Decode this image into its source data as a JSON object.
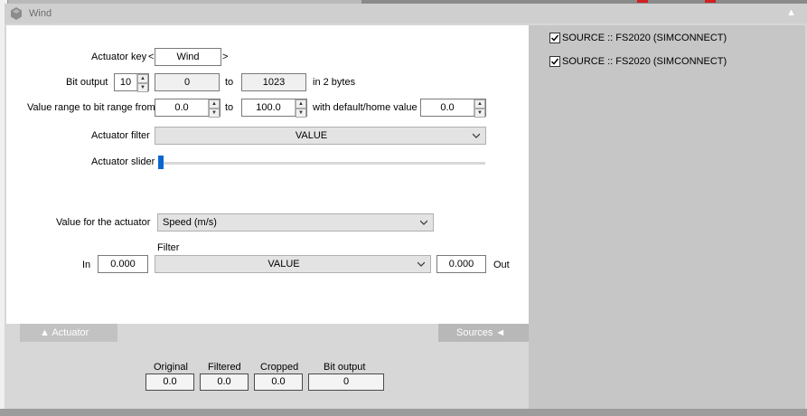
{
  "window": {
    "title": "Wind"
  },
  "actuator_key": {
    "label": "Actuator key",
    "open": "<",
    "value": "Wind",
    "close": ">"
  },
  "bit_output": {
    "label": "Bit output",
    "bits": "10",
    "from": "0",
    "to_label": "to",
    "to": "1023",
    "suffix": "in 2 bytes"
  },
  "value_range": {
    "label": "Value range to bit range from",
    "from": "0.0",
    "to_label": "to",
    "to": "100.0",
    "default_label": "with default/home value",
    "default": "0.0"
  },
  "actuator_filter": {
    "label": "Actuator filter",
    "value": "VALUE"
  },
  "actuator_slider": {
    "label": "Actuator slider",
    "level": 0
  },
  "value_for_actuator": {
    "label": "Value for the actuator",
    "value": "Speed (m/s)"
  },
  "filter": {
    "label": "Filter",
    "in_label": "In",
    "in_value": "0.000",
    "value": "VALUE",
    "out_value": "0.000",
    "out_label": "Out"
  },
  "tabs": {
    "actuator": "▲  Actuator",
    "sources": "Sources  ◄"
  },
  "outputs": {
    "original_label": "Original",
    "original": "0.0",
    "filtered_label": "Filtered",
    "filtered": "0.0",
    "cropped_label": "Cropped",
    "cropped": "0.0",
    "bit_output_label": "Bit output",
    "bit_output": "0"
  },
  "sources": [
    {
      "label": "SOURCE :: FS2020 (SIMCONNECT)",
      "checked": true
    },
    {
      "label": "SOURCE :: FS2020 (SIMCONNECT)",
      "checked": true
    }
  ],
  "colors": {
    "accent": "#0a67d0",
    "tab_bg": "#b8b8b8",
    "right_panel": "#c6c6c6"
  }
}
